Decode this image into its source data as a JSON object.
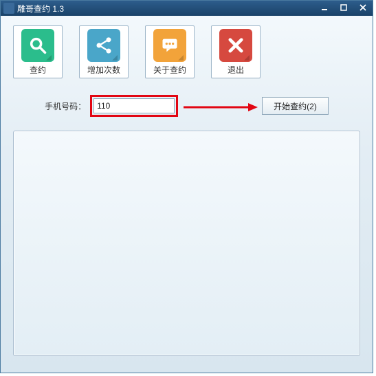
{
  "window": {
    "title": "雕哥查约 1.3"
  },
  "toolbar": {
    "search_label": "查约",
    "add_label": "增加次数",
    "about_label": "关于查约",
    "exit_label": "退出"
  },
  "form": {
    "phone_label": "手机号码：",
    "phone_value": "110",
    "start_label": "开始查约(2)"
  }
}
